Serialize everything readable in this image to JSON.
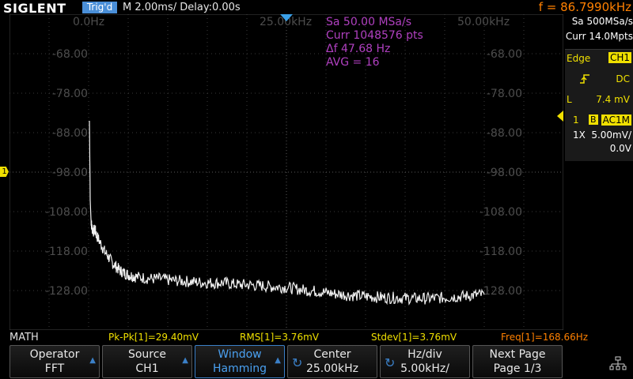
{
  "topbar": {
    "brand": "SIGLENT",
    "trig_state": "Trig'd",
    "timebase": "M 2.00ms/ Delay:0.00s",
    "freq": "f = 86.7990kHz"
  },
  "screen": {
    "freq_labels": [
      "0.0Hz",
      "25.00kHz",
      "50.00kHz"
    ],
    "y_labels": [
      "-68.00",
      "-78.00",
      "-88.00",
      "-98.00",
      "-108.00",
      "-118.00",
      "-128.00"
    ],
    "fft_info": [
      "Sa 50.00 MSa/s",
      "Curr 1048576 pts",
      "Δf 47.68 Hz",
      "AVG = 16"
    ],
    "ch_marker": "1",
    "trace_color": "#f0f0f0",
    "marker_color": "#f0e000",
    "center_marker_color": "#3aa0e8"
  },
  "right_panel": {
    "sa": "Sa 500MSa/s",
    "curr": "Curr 14.0Mpts",
    "trigger": {
      "mode": "Edge",
      "source": "CH1",
      "coupling": "DC",
      "level_label": "L",
      "level": "7.4 mV"
    },
    "channel": {
      "num": "1",
      "bw": "B",
      "coupling": "AC1M",
      "probe": "1X",
      "vdiv": "5.00mV/",
      "offset": "0.0V"
    }
  },
  "measurements": {
    "mode": "MATH",
    "pkpk": "Pk-Pk[1]=29.40mV",
    "rms": "RMS[1]=3.76mV",
    "stdev": "Stdev[1]=3.76mV",
    "freq": "Freq[1]=168.66Hz"
  },
  "menu": [
    {
      "line1": "Operator",
      "line2": "FFT"
    },
    {
      "line1": "Source",
      "line2": "CH1"
    },
    {
      "line1": "Window",
      "line2": "Hamming"
    },
    {
      "line1": "Center",
      "line2": "25.00kHz"
    },
    {
      "line1": "Hz/div",
      "line2": "5.00kHz/"
    },
    {
      "line1": "Next Page",
      "line2": "Page 1/3"
    }
  ],
  "chart_data": {
    "type": "line",
    "xlabel": "",
    "ylabel": "",
    "xunit": "kHz",
    "xlim": [
      0,
      50
    ],
    "ylim": [
      -138,
      -58
    ],
    "x_ticks": [
      "0.0Hz",
      "25.00kHz",
      "50.00kHz"
    ],
    "y_ticks": [
      -68,
      -78,
      -88,
      -98,
      -108,
      -118,
      -128
    ],
    "series": [
      {
        "values_x": [
          0.1,
          0.15,
          0.2,
          0.3,
          0.4,
          0.6,
          0.8,
          1.0,
          1.5,
          2.0,
          2.5,
          3.0,
          3.5,
          4.0,
          4.5,
          5.0,
          5.5,
          6.0,
          7,
          8,
          9,
          10,
          11,
          12,
          13,
          14,
          15,
          16,
          17,
          18,
          19,
          20,
          21,
          22,
          23,
          24,
          25,
          26,
          27,
          28,
          29,
          30,
          31,
          32,
          33,
          34,
          35,
          36,
          37,
          38,
          39,
          40,
          41,
          42,
          43,
          44,
          45,
          46,
          47,
          48,
          49,
          50
        ],
        "values_y": [
          -85,
          -95,
          -105,
          -110,
          -112,
          -113,
          -112.5,
          -114,
          -116,
          -118,
          -119.5,
          -121,
          -122,
          -123,
          -123.5,
          -124,
          -124.3,
          -124.5,
          -124.8,
          -125,
          -125,
          -125.3,
          -125.5,
          -125.6,
          -125.8,
          -125.9,
          -126,
          -126.1,
          -126,
          -126.3,
          -126.5,
          -126.5,
          -126.7,
          -126.8,
          -127,
          -127.1,
          -127.2,
          -127.5,
          -127.8,
          -128,
          -128.2,
          -128.5,
          -128.8,
          -129,
          -129.2,
          -129.3,
          -129.5,
          -129.6,
          -129.7,
          -129.8,
          -129.8,
          -129.9,
          -130,
          -130,
          -130,
          -129.9,
          -129.8,
          -129.6,
          -129.5,
          -129.3,
          -129.1,
          -129
        ]
      }
    ]
  }
}
